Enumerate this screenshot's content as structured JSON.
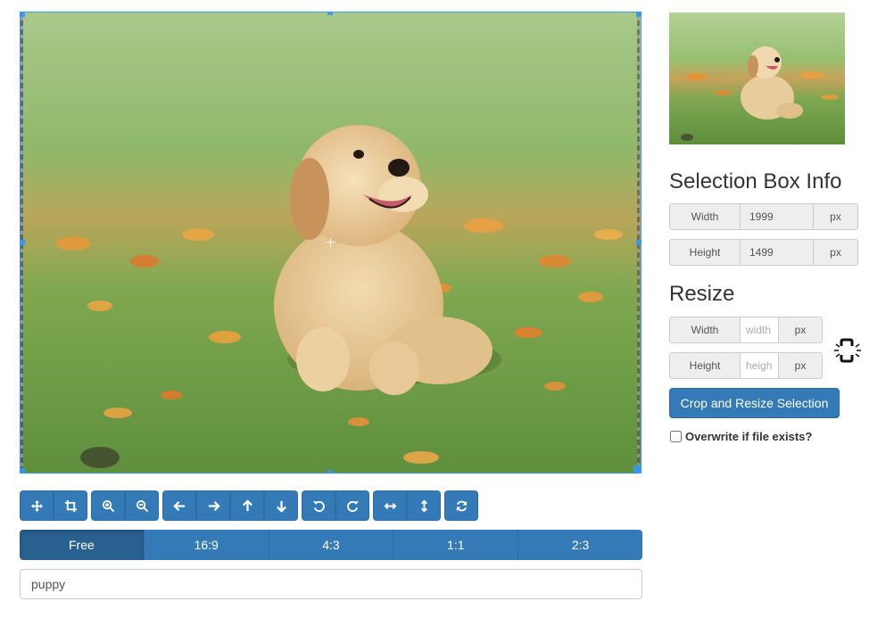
{
  "image_editor": {
    "photo_subject": "golden retriever puppy in a field of flowers",
    "colors": {
      "accent": "#337ab7",
      "accent_active": "#286090",
      "crop_outline": "#3399ff"
    }
  },
  "toolbar": {
    "groups": [
      [
        {
          "icon": "move-icon"
        },
        {
          "icon": "crop-icon"
        }
      ],
      [
        {
          "icon": "zoom-in-icon"
        },
        {
          "icon": "zoom-out-icon"
        }
      ],
      [
        {
          "icon": "arrow-left-icon"
        },
        {
          "icon": "arrow-right-icon"
        },
        {
          "icon": "arrow-up-icon"
        },
        {
          "icon": "arrow-down-icon"
        }
      ],
      [
        {
          "icon": "rotate-left-icon"
        },
        {
          "icon": "rotate-right-icon"
        }
      ],
      [
        {
          "icon": "flip-horizontal-icon"
        },
        {
          "icon": "flip-vertical-icon"
        }
      ],
      [
        {
          "icon": "reset-icon"
        }
      ]
    ]
  },
  "aspect_ratios": {
    "options": [
      "Free",
      "16:9",
      "4:3",
      "1:1",
      "2:3"
    ],
    "selected": "Free"
  },
  "filename": {
    "value": "puppy"
  },
  "selection_info": {
    "title": "Selection Box Info",
    "width_label": "Width",
    "width_value": "1999",
    "height_label": "Height",
    "height_value": "1499",
    "unit": "px"
  },
  "resize": {
    "title": "Resize",
    "width_label": "Width",
    "width_placeholder": "width",
    "height_label": "Height",
    "height_placeholder": "height",
    "unit": "px",
    "link_icon": "unlinked-chain-icon"
  },
  "actions": {
    "crop_button_label": "Crop and Resize Selection",
    "overwrite_label": "Overwrite if file exists?",
    "overwrite_checked": false
  }
}
